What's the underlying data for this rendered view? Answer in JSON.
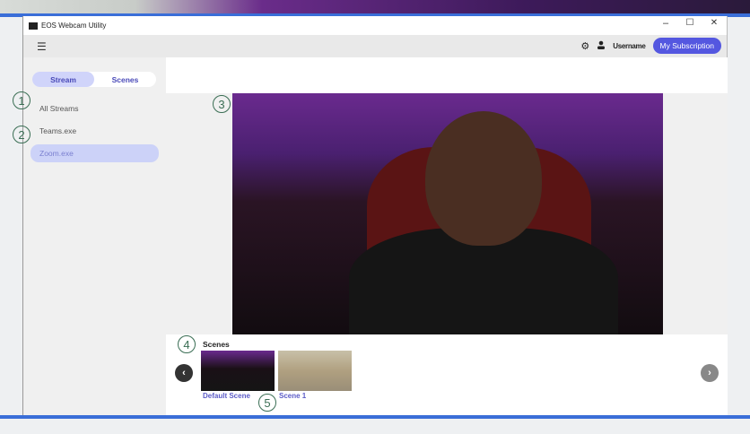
{
  "window": {
    "title": "EOS Webcam Utility",
    "minimize": "–",
    "maximize": "☐",
    "close": "✕"
  },
  "toolbar": {
    "menu_icon": "☰",
    "username": "Username",
    "subscription_label": "My Subscription"
  },
  "sidebar": {
    "tabs": [
      {
        "label": "Stream",
        "active": true
      },
      {
        "label": "Scenes",
        "active": false
      }
    ],
    "items": [
      {
        "label": "All Streams"
      },
      {
        "label": "Teams.exe"
      },
      {
        "label": "Zoom.exe",
        "selected": true
      }
    ]
  },
  "callouts": [
    "1",
    "2",
    "3",
    "4",
    "5"
  ],
  "scenes": {
    "title": "Scenes",
    "items": [
      {
        "label": "Default Scene"
      },
      {
        "label": "Scene 1"
      }
    ],
    "prev": "‹",
    "next": "›"
  },
  "colors": {
    "accent": "#5457e0",
    "selected": "#ccd2f8"
  }
}
